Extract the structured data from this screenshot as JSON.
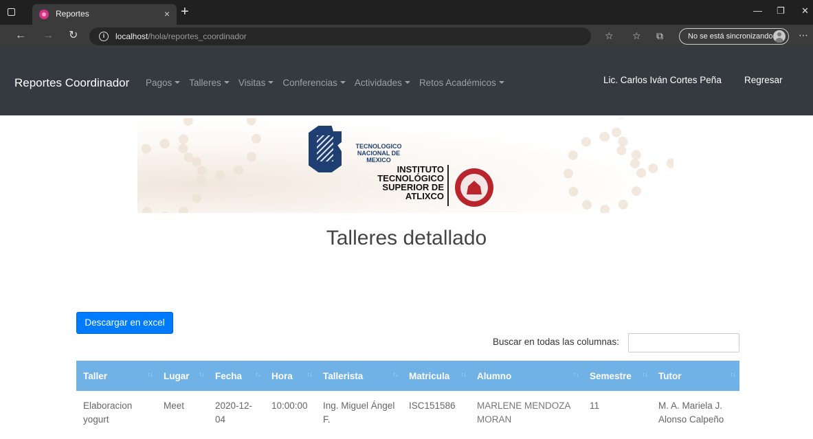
{
  "browser": {
    "tab_title": "Reportes",
    "tab_close": "×",
    "new_tab": "+",
    "url_host": "localhost",
    "url_path": "/hola/reportes_coordinador",
    "sync_status": "No se está sincronizando",
    "icons": [
      "tab-actions-icon",
      "favicon-icon",
      "back-arrow-icon",
      "forward-arrow-icon",
      "refresh-icon",
      "info-icon",
      "add-favorite-icon",
      "favorites-icon",
      "collections-icon",
      "profile-icon",
      "more-icon",
      "minimize-icon",
      "restore-icon",
      "close-window-icon"
    ]
  },
  "navbar": {
    "brand": "Reportes Coordinador",
    "menu": [
      "Pagos",
      "Talleres",
      "Visitas",
      "Conferencias",
      "Actividades",
      "Retos Académicos"
    ],
    "user": "Lic. Carlos Iván Cortes Peña",
    "back": "Regresar",
    "bg_color": "#343a40"
  },
  "banner": {
    "tecnm_line1": "TECNOLOGICO",
    "tecnm_line2": "NACIONAL DE MEXICO",
    "inst_line1": "INSTITUTO",
    "inst_line2": "TECNOLÓGICO",
    "inst_line3": "SUPERIOR DE",
    "inst_line4": "ATLIXCO"
  },
  "main": {
    "title": "Talleres detallado",
    "excel_button": "Descargar en excel",
    "search_label": "Buscar en todas las columnas:",
    "search_value": ""
  },
  "table": {
    "header_color": "#71b2e6",
    "columns": [
      "Taller",
      "Lugar",
      "Fecha",
      "Hora",
      "Tallerista",
      "Matricula",
      "Alumno",
      "Semestre",
      "Tutor"
    ],
    "rows": [
      [
        "Elaboracion yogurt",
        "Meet",
        "2020-12-04",
        "10:00:00",
        "Ing. Miguel Ángel F.",
        "ISC151586",
        "MARLENE MENDOZA MORAN",
        "11",
        "M. A. Mariela J. Alonso Calpeño"
      ]
    ]
  },
  "colors": {
    "primary_button": "#007bff"
  }
}
